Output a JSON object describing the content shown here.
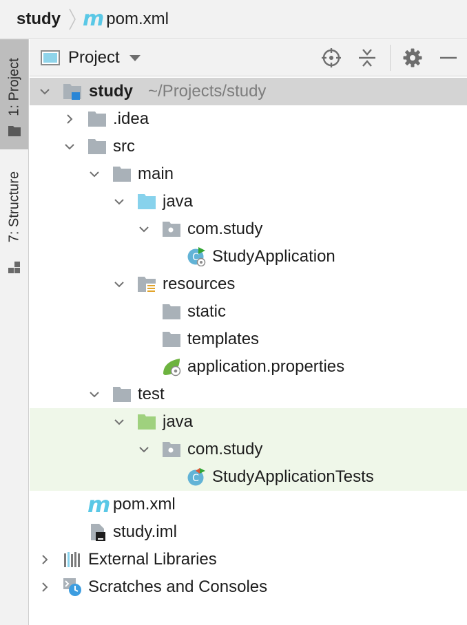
{
  "breadcrumb": {
    "root": "study",
    "file_icon": "maven-m-icon",
    "file": "pom.xml",
    "m": "m"
  },
  "side_tabs": [
    {
      "label": "1: Project",
      "icon": "folder-icon"
    },
    {
      "label": "7: Structure",
      "icon": "structure-icon"
    }
  ],
  "toolbar": {
    "view_label": "Project",
    "buttons": [
      "locate-icon",
      "collapse-all-icon",
      "gear-icon",
      "minimize-icon"
    ]
  },
  "tree": {
    "root": {
      "label": "study",
      "path": "~/Projects/study"
    },
    "idea": ".idea",
    "src": "src",
    "main": "main",
    "main_java": "java",
    "main_pkg": "com.study",
    "main_class": "StudyApplication",
    "resources": "resources",
    "static": "static",
    "templates": "templates",
    "app_props": "application.properties",
    "test": "test",
    "test_java": "java",
    "test_pkg": "com.study",
    "test_class": "StudyApplicationTests",
    "pom": "pom.xml",
    "iml": "study.iml",
    "ext_libs": "External Libraries",
    "scratches": "Scratches and Consoles"
  },
  "colors": {
    "selection": "#d4d4d4",
    "test_background": "#eff7e9",
    "source_folder": "#87d2ec",
    "test_folder": "#9fd17e",
    "folder": "#a9b1b8",
    "maven": "#5ac8e6"
  }
}
